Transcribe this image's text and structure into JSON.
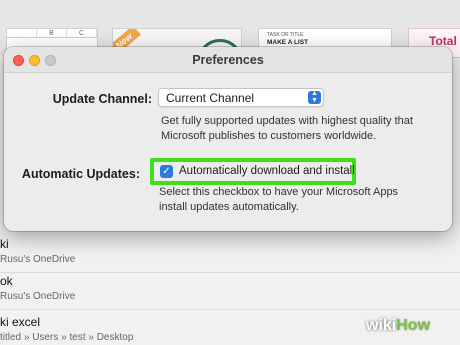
{
  "background": {
    "sheet_columns": [
      "B",
      "C"
    ],
    "ribbon_text": "New",
    "list_template": {
      "kicker": "TASK OR TITLE",
      "title": "MAKE A LIST"
    },
    "total_template": "Total a",
    "recent_files": [
      {
        "name": "ki",
        "path": "Rusu's OneDrive"
      },
      {
        "name": "ok",
        "path": "Rusu's OneDrive"
      },
      {
        "name": "ki excel",
        "path": "titled » Users » test » Desktop"
      }
    ]
  },
  "window": {
    "title": "Preferences",
    "update_channel": {
      "label": "Update Channel:",
      "selected": "Current Channel",
      "description": "Get fully supported updates with highest quality that Microsoft publishes to customers worldwide."
    },
    "automatic_updates": {
      "label": "Automatic Updates:",
      "checkbox_label": "Automatically download and install",
      "checked": true,
      "description": "Select this checkbox to have your Microsoft Apps install updates automatically."
    }
  },
  "watermark": {
    "part1": "wiki",
    "part2": "How"
  },
  "colors": {
    "accent": "#2a7ae2",
    "highlight": "#3fde1a",
    "close": "#ff5f57",
    "minimize": "#febc2e"
  }
}
